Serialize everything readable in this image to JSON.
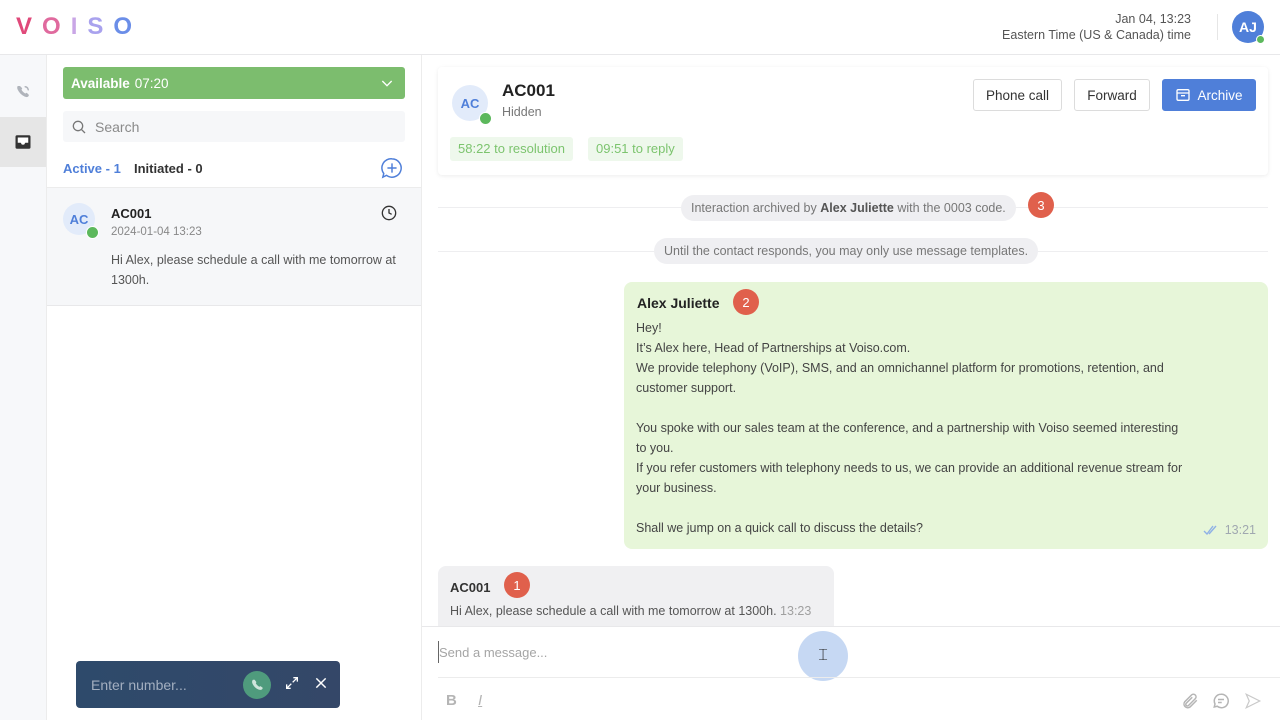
{
  "app": {
    "logo_letters": [
      "V",
      "O",
      "I",
      "S",
      "O"
    ],
    "logo_colors": [
      "#e0497a",
      "#e06a9e",
      "#c9a6e6",
      "#a9a2ee",
      "#6b8ee8"
    ]
  },
  "header": {
    "date": "Jan 04, 13:23",
    "timezone": "Eastern Time (US & Canada) time",
    "user_initials": "AJ",
    "user_status_color": "#5cb85c"
  },
  "rail": {
    "items": [
      {
        "icon": "phone-activity-icon",
        "active": false
      },
      {
        "icon": "inbox-icon",
        "active": true
      }
    ]
  },
  "left_panel": {
    "status": {
      "label": "Available",
      "timer": "07:20",
      "color": "#7cbd6e"
    },
    "search_placeholder": "Search",
    "tabs": [
      {
        "label": "Active - 1",
        "active": true
      },
      {
        "label": "Initiated - 0",
        "active": false
      }
    ],
    "conversations": [
      {
        "initials": "AC",
        "name": "AC001",
        "timestamp": "2024-01-04 13:23",
        "preview": "Hi Alex, please schedule a call with me tomorrow at 1300h.",
        "channel": "whatsapp"
      }
    ]
  },
  "dialer": {
    "placeholder": "Enter number..."
  },
  "contact": {
    "initials": "AC",
    "name": "AC001",
    "subtitle": "Hidden",
    "timers": [
      "58:22 to resolution",
      "09:51 to reply"
    ],
    "actions": {
      "phone_call": "Phone call",
      "forward": "Forward",
      "archive": "Archive"
    }
  },
  "system_messages": [
    {
      "prefix": "Interaction archived by ",
      "bold": "Alex Juliette",
      "suffix": " with the 0003 code.",
      "badge": "3"
    },
    {
      "text": "Until the contact responds, you may only use message templates."
    }
  ],
  "messages": [
    {
      "direction": "outgoing",
      "sender": "Alex Juliette",
      "badge": "2",
      "body": "Hey!\nIt’s Alex here, Head of Partnerships at Voiso.com.\nWe provide telephony (VoIP), SMS, and an omnichannel platform for promotions, retention, and\ncustomer support.\n\nYou spoke with our sales team at the conference, and a partnership with Voiso seemed interesting\nto you.\nIf you refer customers with telephony needs to us, we can provide an additional revenue stream for\nyour business.\n\nShall we jump on a quick call to discuss the details?",
      "time": "13:21",
      "status": "read"
    },
    {
      "direction": "incoming",
      "sender": "AC001",
      "badge": "1",
      "body": "Hi Alex, please schedule a call with me tomorrow at 1300h.",
      "time": "13:23"
    }
  ],
  "composer": {
    "placeholder": "Send a message...",
    "bold_label": "B",
    "italic_label": "I"
  }
}
